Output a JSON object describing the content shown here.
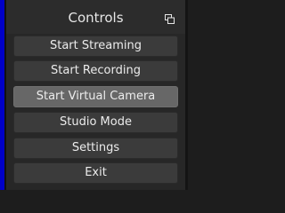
{
  "dock": {
    "title": "Controls",
    "float_icon": "undock-icon",
    "buttons": [
      {
        "label": "Start Streaming",
        "name": "start-streaming-button",
        "state": "normal"
      },
      {
        "label": "Start Recording",
        "name": "start-recording-button",
        "state": "normal"
      },
      {
        "label": "Start Virtual Camera",
        "name": "start-virtual-camera-button",
        "state": "hover"
      },
      {
        "label": "Studio Mode",
        "name": "studio-mode-button",
        "state": "normal"
      },
      {
        "label": "Settings",
        "name": "settings-button",
        "state": "normal"
      },
      {
        "label": "Exit",
        "name": "exit-button",
        "state": "normal"
      }
    ]
  },
  "colors": {
    "panel": "#272727",
    "button": "#3b3b3b",
    "button_hover": "#676767",
    "text": "#ececec",
    "left_edge": "#0000c8"
  }
}
